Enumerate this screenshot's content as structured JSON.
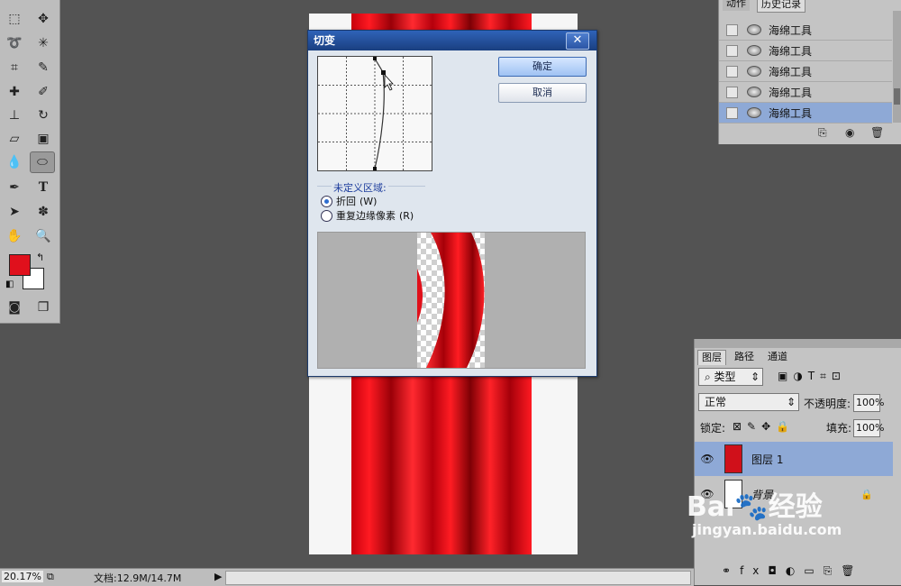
{
  "toolbox": {
    "tools": [
      "marquee-icon",
      "move-icon",
      "lasso-icon",
      "magic-wand-icon",
      "crop-icon",
      "eyedropper-icon",
      "healing-brush-icon",
      "brush-icon",
      "clone-stamp-icon",
      "history-brush-icon",
      "eraser-icon",
      "gradient-icon",
      "blur-icon",
      "sponge-icon",
      "pen-icon",
      "type-icon",
      "path-selection-icon",
      "shape-icon",
      "hand-icon",
      "zoom-icon"
    ],
    "type_glyph": "T",
    "foreground_color": "#e0101c",
    "background_color": "#ffffff"
  },
  "dialog": {
    "title": "切变",
    "ok_label": "确定",
    "cancel_label": "取消",
    "group_title": "未定义区域:",
    "options": [
      {
        "label": "折回",
        "hotkey": "(W)",
        "selected": true
      },
      {
        "label": "重复边缘像素",
        "hotkey": "(R)",
        "selected": false
      }
    ]
  },
  "history": {
    "tabs": [
      "动作",
      "历史记录"
    ],
    "items": [
      {
        "label": "海绵工具",
        "selected": false
      },
      {
        "label": "海绵工具",
        "selected": false
      },
      {
        "label": "海绵工具",
        "selected": false
      },
      {
        "label": "海绵工具",
        "selected": false
      },
      {
        "label": "海绵工具",
        "selected": true
      }
    ]
  },
  "layers": {
    "tabs": [
      "图层",
      "路径",
      "通道"
    ],
    "filter": "类型",
    "blend_mode": "正常",
    "opacity_label": "不透明度:",
    "opacity_value": "100%",
    "lock_label": "锁定:",
    "fill_label": "填充:",
    "fill_value": "100%",
    "items": [
      {
        "name": "图层 1",
        "selected": true,
        "thumb_color": "#d0101a"
      },
      {
        "name": "背景",
        "selected": false,
        "thumb_color": "#ffffff",
        "locked": true
      }
    ],
    "footer_fx": "fx"
  },
  "status": {
    "zoom": "20.17%",
    "doc_size": "文档:12.9M/14.7M"
  },
  "watermark": {
    "brand": "Bai",
    "brand_cn": "经验",
    "url": "jingyan.baidu.com"
  }
}
